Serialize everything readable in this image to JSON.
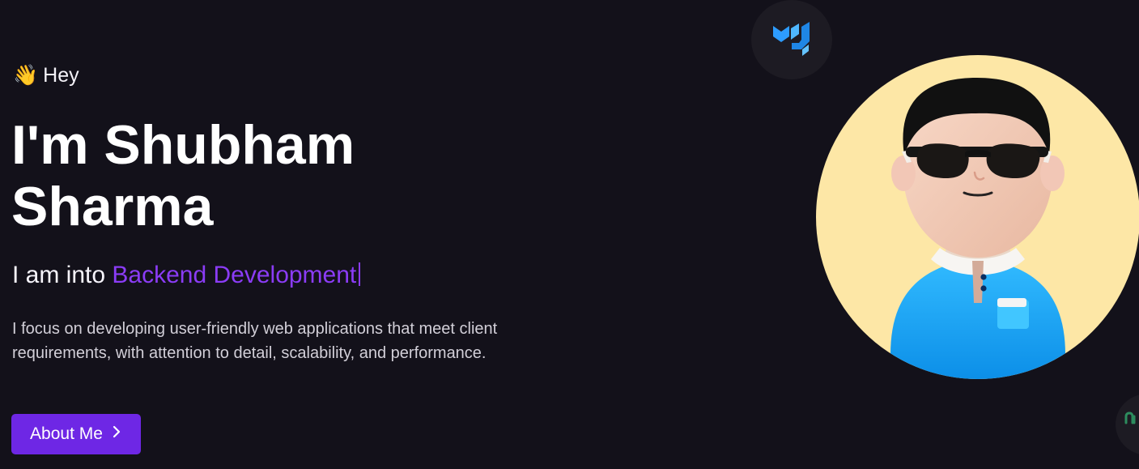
{
  "hero": {
    "greeting_emoji": "👋",
    "greeting_text": "Hey",
    "name_line_1": "I'm Shubham",
    "name_line_2": "Sharma",
    "role_prefix": "I am into",
    "role_highlight": "Backend Development",
    "description": "I focus on developing user-friendly web applications that meet client requirements, with attention to detail, scalability, and performance.",
    "button_label": "About Me"
  },
  "visuals": {
    "tech_icon": "mui-logo-icon",
    "profile_image": "3d-avatar-with-sunglasses",
    "partial_tech_icon": "tech-icon-partial",
    "accent_color": "#8b3cf6",
    "button_color": "#6e27e5",
    "avatar_background": "#fde7a6",
    "page_background": "#13111a"
  }
}
